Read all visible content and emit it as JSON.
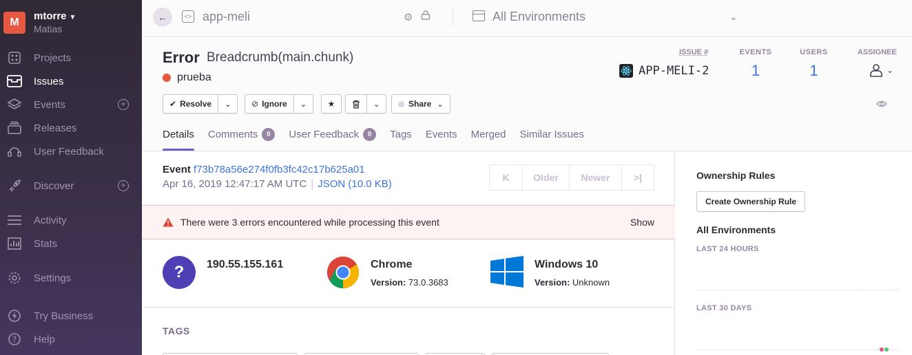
{
  "sidebar": {
    "org_initial": "M",
    "org_name": "mtorre",
    "org_user": "Matias",
    "items": [
      {
        "label": "Projects",
        "icon": "projects-icon"
      },
      {
        "label": "Issues",
        "icon": "issues-icon",
        "active": true
      },
      {
        "label": "Events",
        "icon": "events-icon"
      },
      {
        "label": "Releases",
        "icon": "releases-icon"
      },
      {
        "label": "User Feedback",
        "icon": "feedback-icon"
      },
      {
        "label": "Discover",
        "icon": "discover-icon"
      },
      {
        "label": "Activity",
        "icon": "activity-icon"
      },
      {
        "label": "Stats",
        "icon": "stats-icon"
      },
      {
        "label": "Settings",
        "icon": "settings-icon"
      },
      {
        "label": "Try Business",
        "icon": "business-icon"
      },
      {
        "label": "Help",
        "icon": "help-icon"
      }
    ]
  },
  "header": {
    "project": "app-meli",
    "environment": "All Environments"
  },
  "issue": {
    "type": "Error",
    "subtitle": "Breadcrumb(main.chunk)",
    "culprit": "prueba",
    "actions": {
      "resolve": "Resolve",
      "ignore": "Ignore",
      "share": "Share"
    },
    "issue_label": "ISSUE #",
    "issue_id": "APP-MELI-2",
    "events_label": "EVENTS",
    "events_count": "1",
    "users_label": "USERS",
    "users_count": "1",
    "assignee_label": "ASSIGNEE",
    "tabs": [
      {
        "label": "Details",
        "active": true
      },
      {
        "label": "Comments",
        "badge": "0"
      },
      {
        "label": "User Feedback",
        "badge": "0"
      },
      {
        "label": "Tags"
      },
      {
        "label": "Events"
      },
      {
        "label": "Merged"
      },
      {
        "label": "Similar Issues"
      }
    ]
  },
  "event": {
    "label": "Event",
    "id": "f73b78a56e274f0fb3fc42c17b625a01",
    "date": "Apr 16, 2019 12:47:17 AM UTC",
    "json": "JSON (10.0 KB)",
    "pager": {
      "older": "Older",
      "newer": "Newer"
    }
  },
  "alert": {
    "message": "There were 3 errors encountered while processing this event",
    "action": "Show",
    "color": "#e03e2f"
  },
  "contexts": {
    "user": {
      "title": "190.55.155.161",
      "icon": "?"
    },
    "browser": {
      "title": "Chrome",
      "version_label": "Version:",
      "version": "73.0.3683"
    },
    "os": {
      "title": "Windows 10",
      "version_label": "Version:",
      "version": "Unknown"
    }
  },
  "tags_heading": "TAGS",
  "sidepanel": {
    "ownership_title": "Ownership Rules",
    "create_rule": "Create Ownership Rule",
    "env_title": "All Environments",
    "last24": "LAST 24 HOURS",
    "last30": "LAST 30 DAYS"
  },
  "colors": {
    "accent": "#6c5fc7",
    "link": "#3d74db",
    "org": "#e8573f"
  }
}
